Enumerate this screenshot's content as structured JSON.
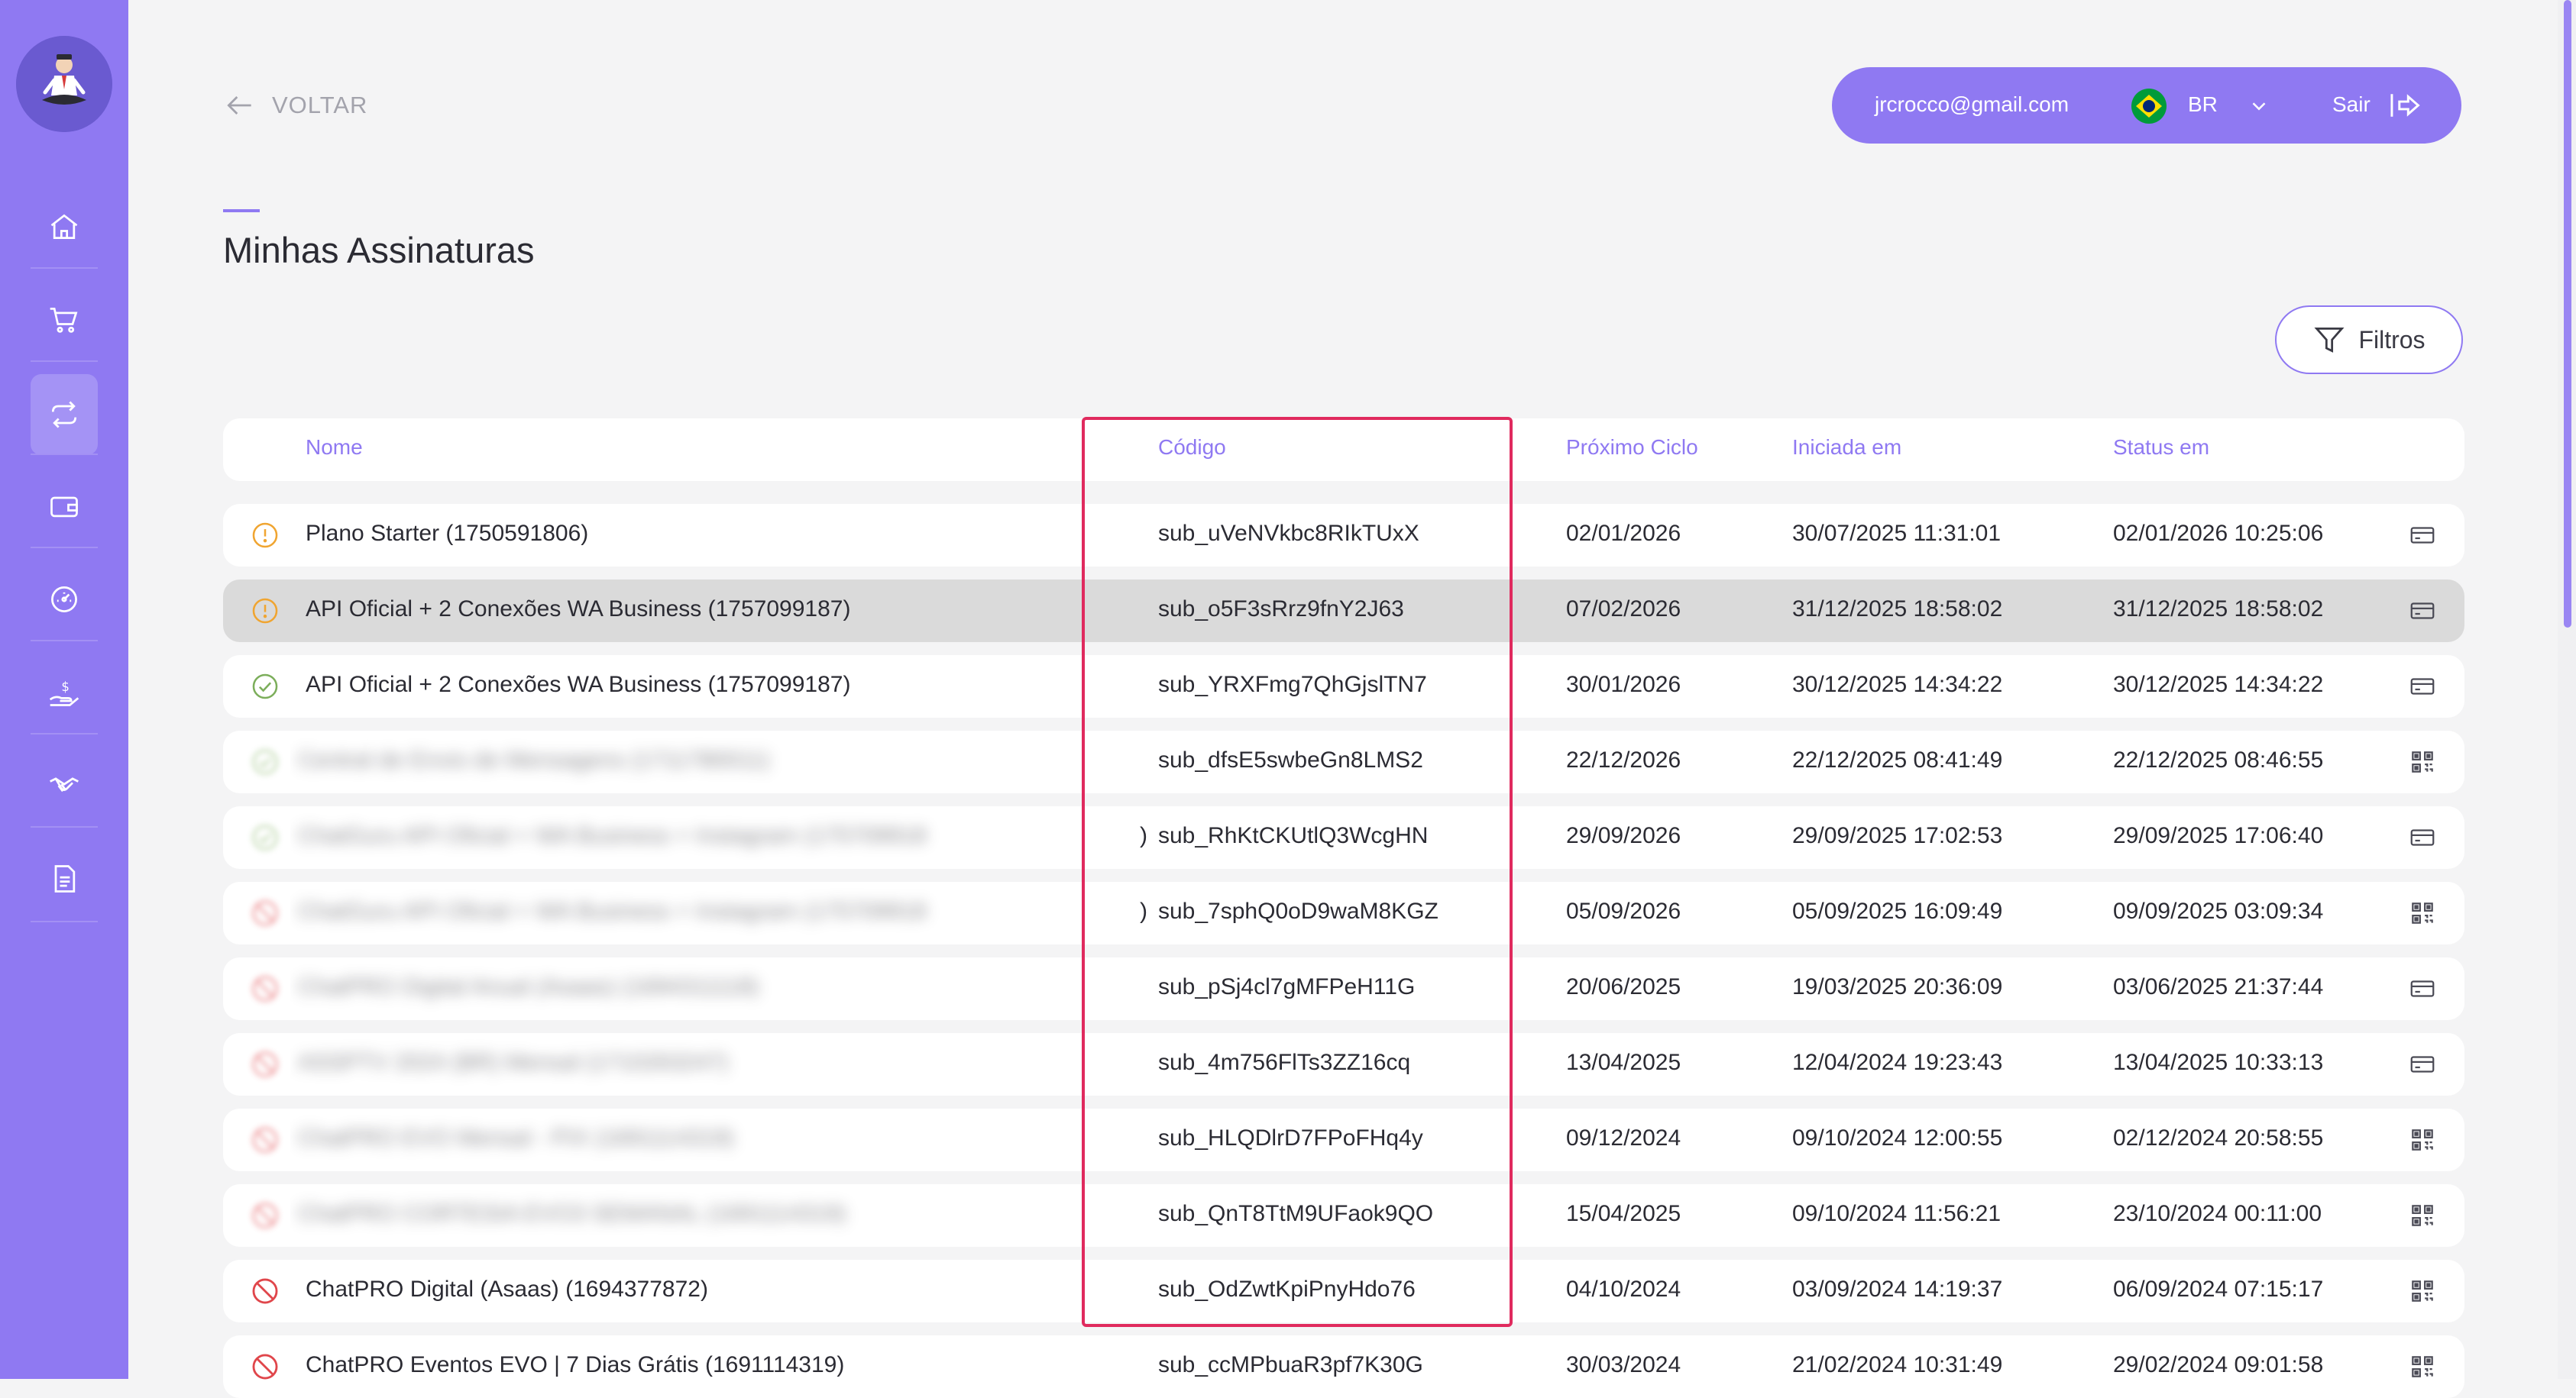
{
  "header": {
    "back_label": "VOLTAR",
    "user_email": "jrcrocco@gmail.com",
    "language": "BR",
    "logout_label": "Sair"
  },
  "page": {
    "title": "Minhas Assinaturas",
    "filters_label": "Filtros"
  },
  "sidebar": {
    "items": [
      {
        "icon": "home-icon"
      },
      {
        "icon": "cart-icon"
      },
      {
        "icon": "subscriptions-icon",
        "active": true
      },
      {
        "icon": "wallet-icon"
      },
      {
        "icon": "dashboard-icon"
      },
      {
        "icon": "money-hand-icon"
      },
      {
        "icon": "handshake-icon"
      },
      {
        "icon": "document-icon"
      }
    ]
  },
  "table": {
    "columns": [
      "Nome",
      "Código",
      "Próximo Ciclo",
      "Iniciada em",
      "Status em"
    ],
    "rows": [
      {
        "status": "warning",
        "name": "Plano Starter (1750591806)",
        "name_tail": "",
        "blurred": false,
        "code": "sub_uVeNVkbc8RIkTUxX",
        "next": "02/01/2026",
        "started": "30/07/2025 11:31:01",
        "status_at": "02/01/2026 10:25:06",
        "payment": "card",
        "highlight": false
      },
      {
        "status": "warning",
        "name": "API Oficial + 2 Conexões WA Business (1757099187)",
        "name_tail": "",
        "blurred": false,
        "code": "sub_o5F3sRrz9fnY2J63",
        "next": "07/02/2026",
        "started": "31/12/2025 18:58:02",
        "status_at": "31/12/2025 18:58:02",
        "payment": "card",
        "highlight": true
      },
      {
        "status": "active",
        "name": "API Oficial + 2 Conexões WA Business (1757099187)",
        "name_tail": "",
        "blurred": false,
        "code": "sub_YRXFmg7QhGjslTN7",
        "next": "30/01/2026",
        "started": "30/12/2025 14:34:22",
        "status_at": "30/12/2025 14:34:22",
        "payment": "card",
        "highlight": false
      },
      {
        "status": "active",
        "name": "Central de Envio de Mensagens (1711780011)",
        "name_tail": "",
        "blurred": true,
        "code": "sub_dfsE5swbeGn8LMS2",
        "next": "22/12/2026",
        "started": "22/12/2025 08:41:49",
        "status_at": "22/12/2025 08:46:55",
        "payment": "pix",
        "highlight": false
      },
      {
        "status": "active",
        "name": "ChatGuru API Oficial + WA Business + Instagram (175709918",
        "name_tail": ")",
        "blurred": true,
        "code": "sub_RhKtCKUtlQ3WcgHN",
        "next": "29/09/2026",
        "started": "29/09/2025 17:02:53",
        "status_at": "29/09/2025 17:06:40",
        "payment": "card",
        "highlight": false
      },
      {
        "status": "cancelled",
        "name": "ChatGuru API Oficial + WA Business + Instagram (175709918",
        "name_tail": ")",
        "blurred": true,
        "code": "sub_7sphQ0oD9waM8KGZ",
        "next": "05/09/2026",
        "started": "05/09/2025 16:09:49",
        "status_at": "09/09/2025 03:09:34",
        "payment": "pix",
        "highlight": false
      },
      {
        "status": "cancelled",
        "name": "ChatPRO Digital Anual (Asaas) (1694311118)",
        "name_tail": "",
        "blurred": true,
        "code": "sub_pSj4cl7gMFPeH11G",
        "next": "20/06/2025",
        "started": "19/03/2025 20:36:09",
        "status_at": "03/06/2025 21:37:44",
        "payment": "card",
        "highlight": false
      },
      {
        "status": "cancelled",
        "name": "ASSPTV 2024 (BR) Mensal (1710263247)",
        "name_tail": "",
        "blurred": true,
        "code": "sub_4m756FlTs3ZZ16cq",
        "next": "13/04/2025",
        "started": "12/04/2024 19:23:43",
        "status_at": "13/04/2025 10:33:13",
        "payment": "card",
        "highlight": false
      },
      {
        "status": "cancelled",
        "name": "ChatPRO EVO Mensal - PIX (1691114319)",
        "name_tail": "",
        "blurred": true,
        "code": "sub_HLQDlrD7FPoFHq4y",
        "next": "09/12/2024",
        "started": "09/10/2024 12:00:55",
        "status_at": "02/12/2024 20:58:55",
        "payment": "pix",
        "highlight": false
      },
      {
        "status": "cancelled",
        "name": "ChatPRO CORTESIA EVO3 SEMANAL (1691114319)",
        "name_tail": "",
        "blurred": true,
        "code": "sub_QnT8TtM9UFaok9QO",
        "next": "15/04/2025",
        "started": "09/10/2024 11:56:21",
        "status_at": "23/10/2024 00:11:00",
        "payment": "pix",
        "highlight": false
      },
      {
        "status": "cancelled",
        "name": "ChatPRO Digital (Asaas) (1694377872)",
        "name_tail": "",
        "blurred": false,
        "code": "sub_OdZwtKpiPnyHdo76",
        "next": "04/10/2024",
        "started": "03/09/2024 14:19:37",
        "status_at": "06/09/2024 07:15:17",
        "payment": "pix",
        "highlight": false
      },
      {
        "status": "cancelled",
        "name": "ChatPRO Eventos EVO | 7 Dias Grátis (1691114319)",
        "name_tail": "",
        "blurred": false,
        "code": "sub_ccMPbuaR3pf7K30G",
        "next": "30/03/2024",
        "started": "21/02/2024 10:31:49",
        "status_at": "29/02/2024 09:01:58",
        "payment": "pix",
        "highlight": false
      }
    ]
  },
  "colors": {
    "accent": "#8f79f2",
    "warning": "#f0a531",
    "active": "#7cae5b",
    "cancelled": "#e0464b",
    "highlight_border": "#e02a5e"
  }
}
